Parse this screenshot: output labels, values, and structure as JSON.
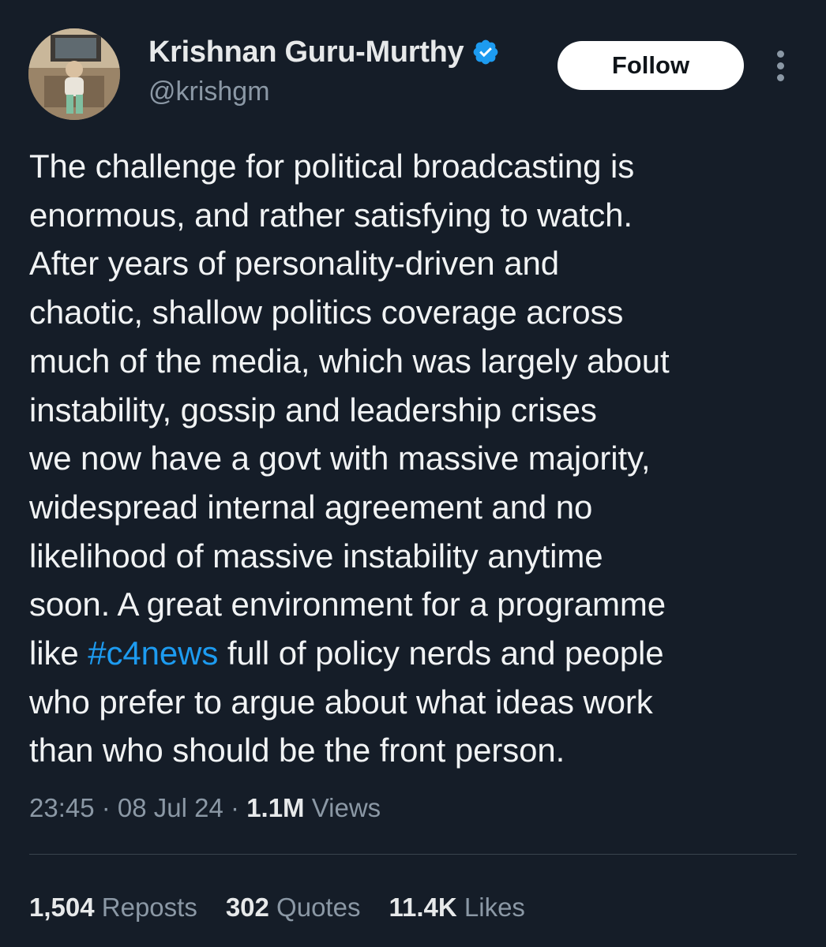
{
  "author": {
    "display_name": "Krishnan Guru-Murthy",
    "handle": "@krishgm",
    "verified_icon": "verified-badge-icon",
    "verified_color": "#1d9bf0"
  },
  "actions": {
    "follow_label": "Follow",
    "more_icon": "more-vertical-icon"
  },
  "tweet": {
    "lines_before": [
      "The challenge for political broadcasting is",
      "enormous, and rather satisfying to watch.",
      "After years of personality-driven and",
      "chaotic, shallow politics coverage across",
      "much of the media, which was largely about",
      "instability, gossip and leadership crises",
      "we now have a govt with massive majority,",
      "widespread internal agreement and no",
      "likelihood of massive instability anytime",
      "soon. A great environment for a programme"
    ],
    "hashtag_line_prefix": "like ",
    "hashtag": "#c4news",
    "hashtag_line_suffix": " full of policy nerds and people",
    "lines_after": [
      "who prefer to argue about what ideas work",
      "than who should be the front person."
    ]
  },
  "meta": {
    "time": "23:45",
    "separator": " · ",
    "date": "08 Jul 24",
    "views_count": "1.1M",
    "views_label": " Views"
  },
  "stats": {
    "reposts_count": "1,504",
    "reposts_label": " Reposts",
    "quotes_count": "302",
    "quotes_label": " Quotes",
    "likes_count": "11.4K",
    "likes_label": " Likes"
  },
  "colors": {
    "background": "#151d28",
    "text": "#f1f3f4",
    "secondary": "#8b98a5",
    "link": "#1d9bf0",
    "divider": "#38444d"
  }
}
